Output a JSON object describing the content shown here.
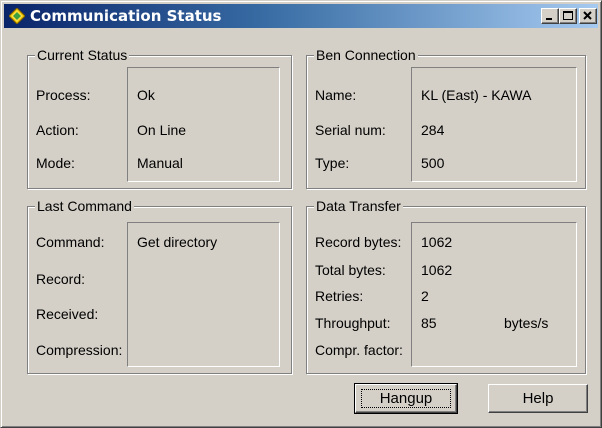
{
  "window": {
    "title": "Communication Status"
  },
  "current_status": {
    "legend": "Current Status",
    "rows": [
      {
        "label": "Process:",
        "value": "Ok"
      },
      {
        "label": "Action:",
        "value": "On Line"
      },
      {
        "label": "Mode:",
        "value": "Manual"
      }
    ]
  },
  "ben_connection": {
    "legend": "Ben Connection",
    "rows": [
      {
        "label": "Name:",
        "value": "KL (East) - KAWA"
      },
      {
        "label": "Serial num:",
        "value": "284"
      },
      {
        "label": "Type:",
        "value": "500"
      }
    ]
  },
  "last_command": {
    "legend": "Last Command",
    "rows": [
      {
        "label": "Command:",
        "value": "Get directory"
      },
      {
        "label": "Record:",
        "value": ""
      },
      {
        "label": "Received:",
        "value": ""
      },
      {
        "label": "Compression:",
        "value": ""
      }
    ]
  },
  "data_transfer": {
    "legend": "Data Transfer",
    "rows": [
      {
        "label": "Record bytes:",
        "value": "1062"
      },
      {
        "label": "Total bytes:",
        "value": "1062"
      },
      {
        "label": "Retries:",
        "value": "2"
      },
      {
        "label": "Throughput:",
        "value": "85",
        "unit": "bytes/s"
      },
      {
        "label": "Compr. factor:",
        "value": ""
      }
    ]
  },
  "buttons": {
    "hangup": "Hangup",
    "help": "Help"
  },
  "icons": {
    "app": "app-diamond-icon",
    "minimize": "minimize-icon",
    "maximize": "maximize-icon",
    "close": "close-icon"
  }
}
